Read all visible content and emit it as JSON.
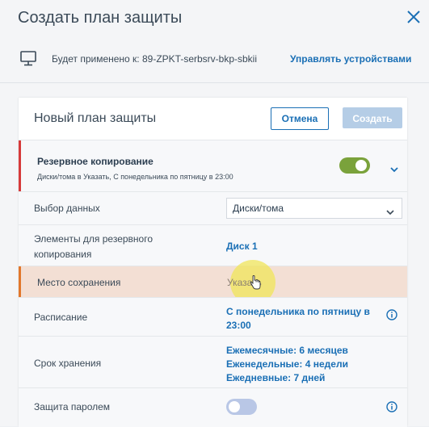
{
  "header": {
    "title": "Создать план защиты"
  },
  "device": {
    "applied_to": "Будет применено к: 89-ZPKT-serbsrv-bkp-sbkii",
    "manage_link": "Управлять устройствами"
  },
  "plan": {
    "title": "Новый план защиты",
    "cancel_label": "Отмена",
    "create_label": "Создать",
    "backup": {
      "title": "Резервное копирование",
      "summary": "Диски/тома в Указать, С понедельника по пятницу в 23:00",
      "enabled": true
    },
    "rows": {
      "data_selection": {
        "label": "Выбор данных",
        "value": "Диски/тома"
      },
      "backup_items": {
        "label": "Элементы для резервного копирования",
        "value": "Диск 1"
      },
      "destination": {
        "label": "Место сохранения",
        "value": "Указать"
      },
      "schedule": {
        "label": "Расписание",
        "value": "С понедельника по пятницу в 23:00"
      },
      "retention": {
        "label": "Срок хранения",
        "monthly": "Ежемесячные: 6 месяцев",
        "weekly": "Еженедельные: 4 недели",
        "daily": "Ежедневные: 7 дней"
      },
      "password": {
        "label": "Защита паролем",
        "enabled": false
      }
    }
  },
  "colors": {
    "accent": "#1a6fb5",
    "toggle_on": "#7aa23b",
    "section_bar": "#d63a3a",
    "highlight_bar": "#e2772c"
  }
}
